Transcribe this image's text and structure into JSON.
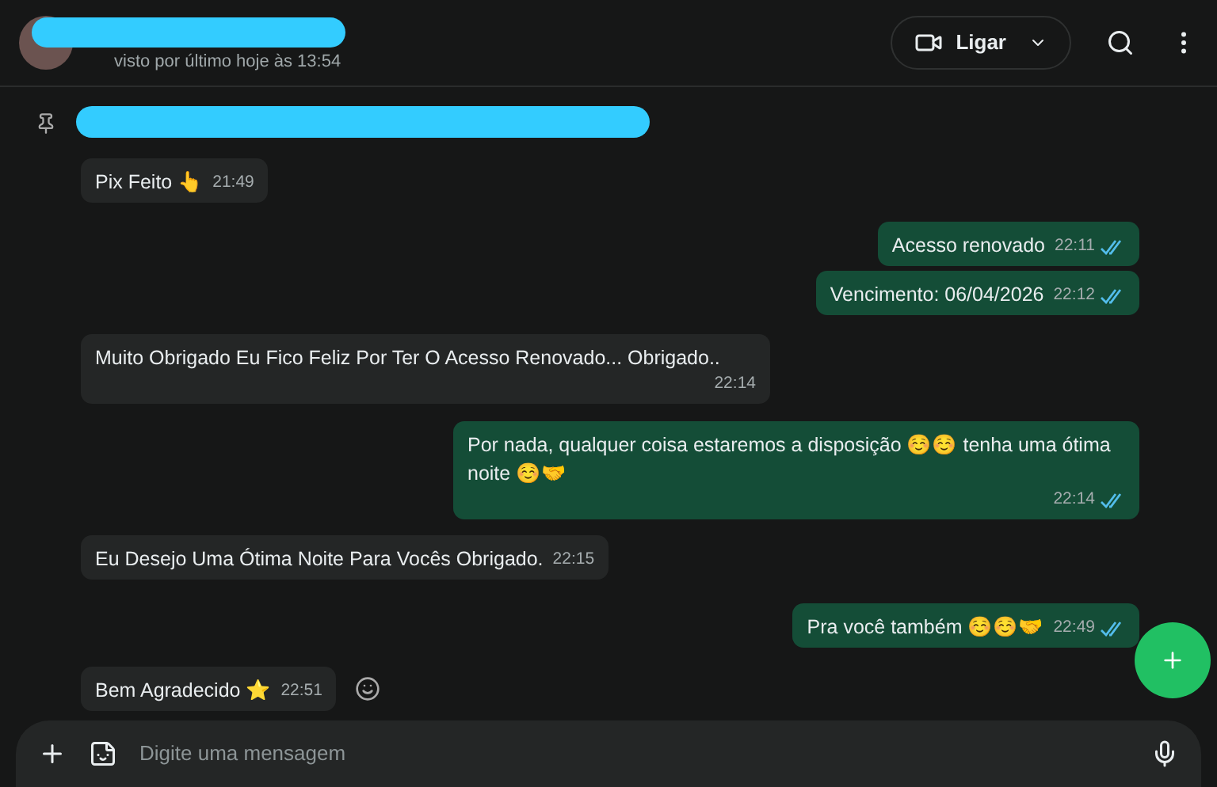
{
  "header": {
    "status": "visto por último hoje às 13:54",
    "call_button": "Ligar"
  },
  "messages": [
    {
      "kind": "incoming",
      "text": "Pix Feito 👆",
      "time": "21:49"
    },
    {
      "kind": "outgoing",
      "text": "Acesso renovado",
      "time": "22:11",
      "read": true
    },
    {
      "kind": "outgoing",
      "text": "Vencimento: 06/04/2026",
      "time": "22:12",
      "read": true
    },
    {
      "kind": "incoming",
      "text": "Muito Obrigado Eu Fico Feliz Por Ter O Acesso Renovado... Obrigado..",
      "time": "22:14",
      "time_below": true
    },
    {
      "kind": "outgoing",
      "text": "Por nada, qualquer coisa estaremos a disposição ☺️☺️ tenha uma ótima noite ☺️🤝",
      "time": "22:14",
      "read": true,
      "time_below": true
    },
    {
      "kind": "incoming",
      "text": "Eu Desejo Uma Ótima Noite Para Vocês Obrigado.",
      "time": "22:15"
    },
    {
      "kind": "outgoing",
      "text": "Pra você também ☺️☺️🤝",
      "time": "22:49",
      "read": true
    },
    {
      "kind": "incoming",
      "text": "Bem Agradecido ⭐",
      "time": "22:51",
      "react": true
    }
  ],
  "composer": {
    "placeholder": "Digite uma mensagem"
  }
}
